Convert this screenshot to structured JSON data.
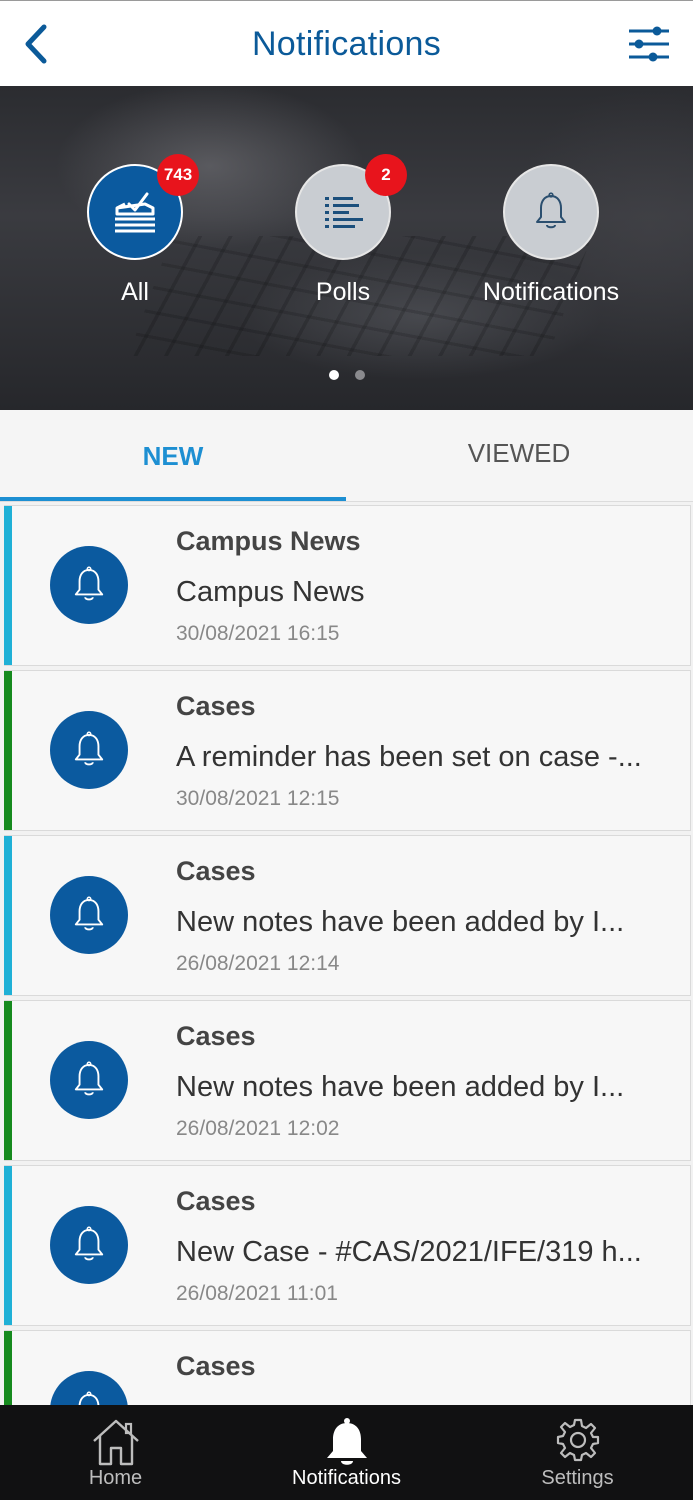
{
  "header": {
    "title": "Notifications",
    "back_icon": "chevron-left-icon",
    "filter_icon": "sliders-icon"
  },
  "categories": [
    {
      "label": "All",
      "badge": "743",
      "icon": "ballot-box-icon",
      "active": true
    },
    {
      "label": "Polls",
      "badge": "2",
      "icon": "list-icon",
      "active": false
    },
    {
      "label": "Notifications",
      "badge": "",
      "icon": "bell-icon",
      "active": false
    }
  ],
  "pager": {
    "pages": 2,
    "current": 1
  },
  "tabs": {
    "new_label": "NEW",
    "viewed_label": "VIEWED",
    "selected": "NEW"
  },
  "notifications": [
    {
      "category": "Campus News",
      "message": "Campus News",
      "time": "30/08/2021 16:15",
      "accent": "#1fb0d6"
    },
    {
      "category": "Cases",
      "message": "A reminder has been set on case -...",
      "time": "30/08/2021 12:15",
      "accent": "#168a1e"
    },
    {
      "category": "Cases",
      "message": "New notes have been added by I...",
      "time": "26/08/2021 12:14",
      "accent": "#1fb0d6"
    },
    {
      "category": "Cases",
      "message": "New notes have been added by I...",
      "time": "26/08/2021 12:02",
      "accent": "#168a1e"
    },
    {
      "category": "Cases",
      "message": "New Case - #CAS/2021/IFE/319 h...",
      "time": "26/08/2021 11:01",
      "accent": "#1fb0d6"
    },
    {
      "category": "Cases",
      "message": "",
      "time": "",
      "accent": "#168a1e"
    }
  ],
  "bottom_nav": {
    "home_label": "Home",
    "notifications_label": "Notifications",
    "settings_label": "Settings",
    "selected": "Notifications"
  },
  "colors": {
    "primary": "#0b5a99",
    "tab_active": "#1d8fd2",
    "badge": "#e8141c"
  }
}
